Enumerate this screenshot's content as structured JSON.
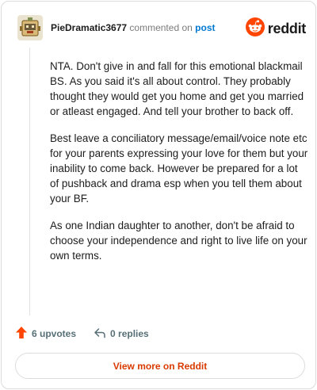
{
  "comment": {
    "username": "PieDramatic3677",
    "action_text": "commented on",
    "link_text": "post",
    "paragraphs": [
      "NTA. Don't give in and fall for this emotional blackmail BS. As you said it's all about control. They probably thought they would get you home and get you married or atleast engaged. And tell your brother to back off.",
      "Best leave a conciliatory message/email/voice note etc for your parents expressing your love for them but your inability to come back. However be prepared for a lot of pushback and drama esp when you tell them about your BF.",
      "As one Indian daughter to another, don't be afraid to choose your independence and right to live life on your own terms."
    ]
  },
  "brand": {
    "name": "reddit",
    "icon": "reddit-snoo-icon",
    "color": "#ff4500"
  },
  "actions": {
    "upvotes_label": "6 upvotes",
    "replies_label": "0 replies",
    "upvote_icon": "upvote-arrow-icon",
    "reply_icon": "reply-arrow-icon",
    "upvote_color": "#ff4500"
  },
  "view_more_label": "View more on Reddit",
  "colors": {
    "link": "#0079d3",
    "accent": "#d93a00",
    "muted": "#576f76"
  }
}
